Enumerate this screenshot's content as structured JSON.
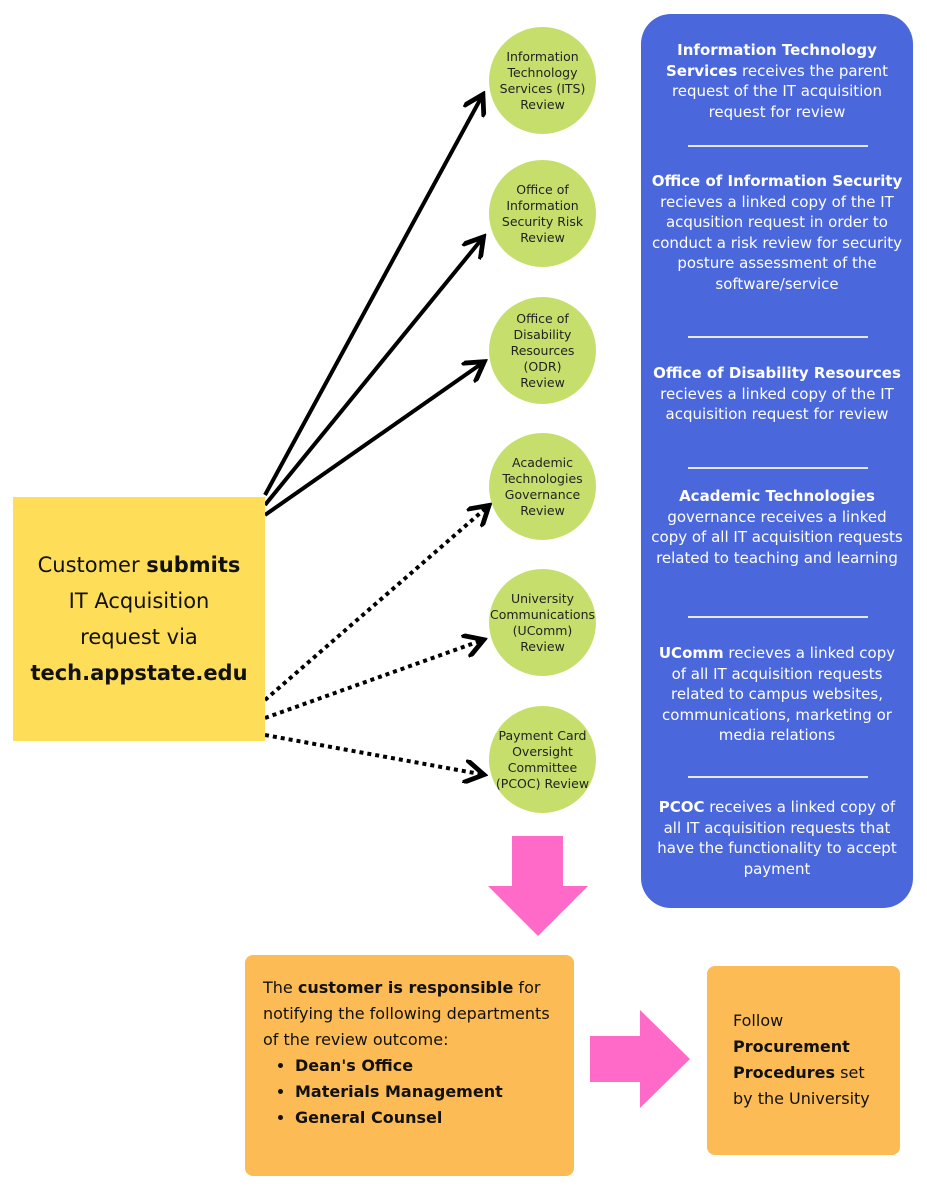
{
  "customer_box": {
    "pre": "Customer ",
    "bold1": "submits",
    "mid": "IT Acquisition request via",
    "bold2": "tech.appstate.edu"
  },
  "reviews": [
    "Information Technology Services (ITS) Review",
    "Office of Information Security Risk Review",
    "Office of Disability Resources (ODR) Review",
    "Academic Technologies Governance Review",
    "University Communications (UComm) Review",
    "Payment Card Oversight Committee (PCOC) Review"
  ],
  "panel": [
    {
      "bold": "Information Technology Services",
      "text": " receives the parent request of the IT acquisition request for review"
    },
    {
      "bold": "Office of Information Security",
      "text": " recieves a linked copy of the IT acqusition request in order to conduct a risk review for security posture assessment of the software/service"
    },
    {
      "bold": "Office of Disability Resources",
      "text": " recieves a linked copy of the IT acquisition request for review"
    },
    {
      "bold": "Academic Technologies",
      "text": " governance receives a linked copy of all IT acquisition requests related to teaching and learning"
    },
    {
      "bold": "UComm",
      "text": " recieves a linked copy of all IT acquisition requests related to campus websites, communications, marketing or media relations"
    },
    {
      "bold": "PCOC",
      "text": " receives a linked copy of all IT acquisition requests that have the functionality to accept payment"
    }
  ],
  "responsibility": {
    "pre": "The ",
    "bold": "customer is responsible",
    "post": " for notifying the following departments of the review outcome:",
    "items": [
      "Dean's Office",
      "Materials Management",
      "General Counsel"
    ]
  },
  "procurement": {
    "pre": "Follow ",
    "bold": "Procurement Procedures",
    "post": " set by the University"
  },
  "colors": {
    "yellow": "#fedd59",
    "green": "#c6df6c",
    "blue": "#4a67dc",
    "orange": "#fcbb55",
    "pink": "#ff6ac8"
  }
}
